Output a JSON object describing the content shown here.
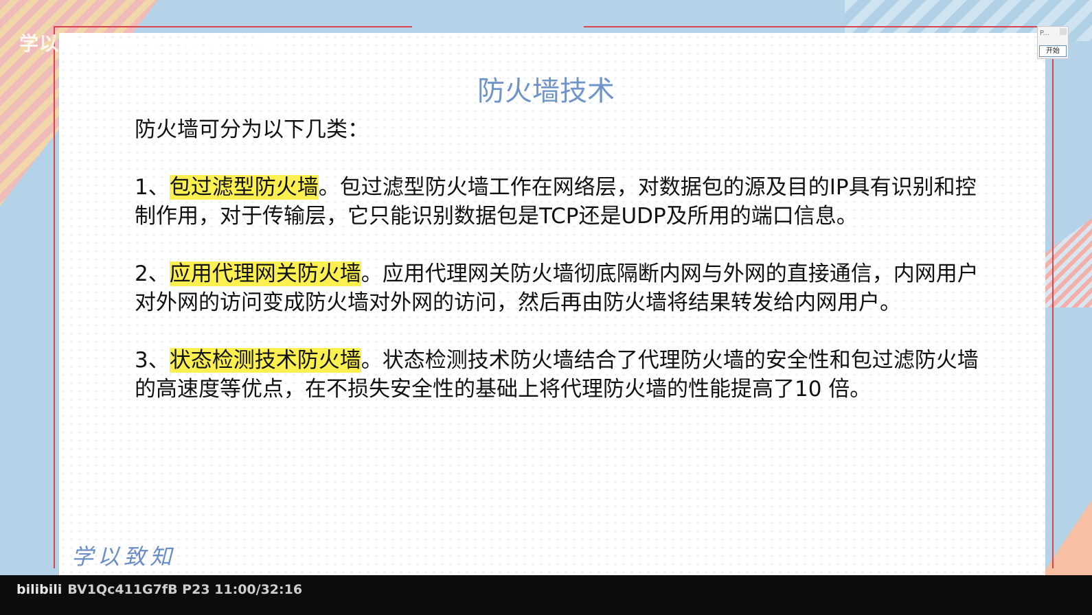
{
  "watermark": "学以致知Learning bilibili",
  "slide": {
    "title": "防火墙技术",
    "intro": "防火墙可分为以下几类：",
    "items": [
      {
        "number": "1、",
        "highlight": "包过滤型防火墙",
        "text": "。包过滤型防火墙工作在网络层，对数据包的源及目的IP具有识别和控制作用，对于传输层，它只能识别数据包是TCP还是UDP及所用的端口信息。"
      },
      {
        "number": "2、",
        "highlight": "应用代理网关防火墙",
        "text": "。应用代理网关防火墙彻底隔断内网与外网的直接通信，内网用户对外网的访问变成防火墙对外网的访问，然后再由防火墙将结果转发给内网用户。"
      },
      {
        "number": "3、",
        "highlight": "状态检测技术防火墙",
        "text": "。状态检测技术防火墙结合了代理防火墙的安全性和包过滤防火墙的高速度等优点，在不损失安全性的基础上将代理防火墙的性能提高了10 倍。"
      }
    ],
    "signature": "学以致知"
  },
  "widget": {
    "label": "P...",
    "start_label": "开始"
  },
  "player": {
    "logo": "bilibili",
    "info": "BV1Qc411G7fB P23 11:00/32:16"
  },
  "colors": {
    "title": "#6f94c9",
    "highlight": "#fbf04f",
    "frame": "#d9434e",
    "background": "#b4d3e8"
  }
}
